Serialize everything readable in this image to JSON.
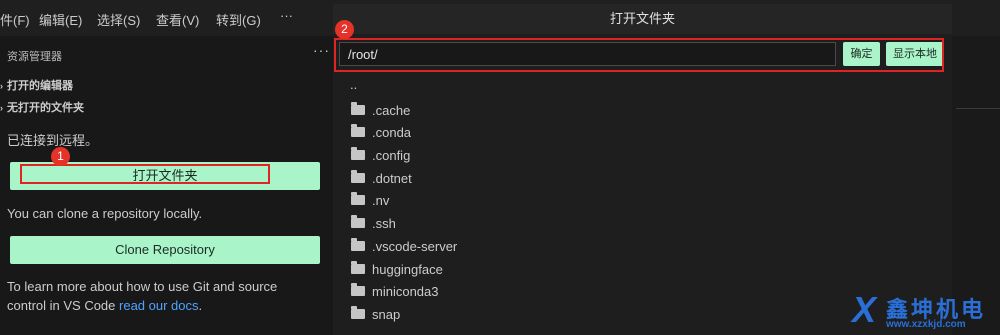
{
  "menu": {
    "items": [
      "件(F)",
      "编辑(E)",
      "选择(S)",
      "查看(V)",
      "转到(G)"
    ],
    "more": "···"
  },
  "sidebar": {
    "title": "资源管理器",
    "more": "···",
    "sections": [
      "打开的编辑器",
      "无打开的文件夹"
    ],
    "connected_text": "已连接到远程。",
    "open_folder_button": "打开文件夹",
    "clone_text": "You can clone a repository locally.",
    "clone_button": "Clone Repository",
    "learn_text_1": "To learn more about how to use Git and source",
    "learn_text_2": "control in VS Code ",
    "learn_link": "read our docs",
    "learn_end": "."
  },
  "dialog": {
    "title": "打开文件夹",
    "path_value": "/root/",
    "confirm_button": "确定",
    "show_local_button": "显示本地",
    "parent_entry": "..",
    "folders": [
      ".cache",
      ".conda",
      ".config",
      ".dotnet",
      ".nv",
      ".ssh",
      ".vscode-server",
      "huggingface",
      "miniconda3",
      "snap"
    ]
  },
  "annotations": {
    "badge_1": "1",
    "badge_2": "2"
  },
  "watermark": {
    "cn": "鑫坤机电",
    "url": "www.xzxkjd.com"
  },
  "colors": {
    "accent_button": "#a9f5c9",
    "annotation_red": "#e02424",
    "link": "#4fa3ff"
  }
}
